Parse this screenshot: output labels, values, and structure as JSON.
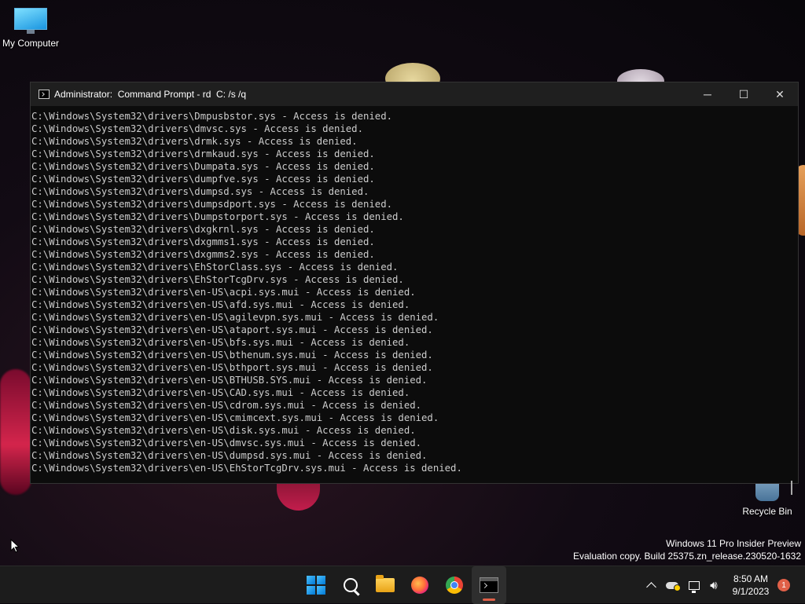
{
  "desktop": {
    "icons": [
      {
        "label": "My Computer",
        "icon": "monitor-icon"
      },
      {
        "label": "Recycle Bin",
        "icon": "recycle-bin-icon"
      }
    ],
    "watermark": {
      "line1": "Windows 11 Pro Insider Preview",
      "line2": "Evaluation copy. Build 25375.zn_release.230520-1632"
    }
  },
  "window": {
    "title": "Administrator:  Command Prompt - rd  C: /s /q",
    "controls": {
      "minimize": "─",
      "maximize": "☐",
      "close": "✕"
    },
    "console_lines": [
      "C:\\Windows\\System32\\drivers\\Dmpusbstor.sys - Access is denied.",
      "C:\\Windows\\System32\\drivers\\dmvsc.sys - Access is denied.",
      "C:\\Windows\\System32\\drivers\\drmk.sys - Access is denied.",
      "C:\\Windows\\System32\\drivers\\drmkaud.sys - Access is denied.",
      "C:\\Windows\\System32\\drivers\\Dumpata.sys - Access is denied.",
      "C:\\Windows\\System32\\drivers\\dumpfve.sys - Access is denied.",
      "C:\\Windows\\System32\\drivers\\dumpsd.sys - Access is denied.",
      "C:\\Windows\\System32\\drivers\\dumpsdport.sys - Access is denied.",
      "C:\\Windows\\System32\\drivers\\Dumpstorport.sys - Access is denied.",
      "C:\\Windows\\System32\\drivers\\dxgkrnl.sys - Access is denied.",
      "C:\\Windows\\System32\\drivers\\dxgmms1.sys - Access is denied.",
      "C:\\Windows\\System32\\drivers\\dxgmms2.sys - Access is denied.",
      "C:\\Windows\\System32\\drivers\\EhStorClass.sys - Access is denied.",
      "C:\\Windows\\System32\\drivers\\EhStorTcgDrv.sys - Access is denied.",
      "C:\\Windows\\System32\\drivers\\en-US\\acpi.sys.mui - Access is denied.",
      "C:\\Windows\\System32\\drivers\\en-US\\afd.sys.mui - Access is denied.",
      "C:\\Windows\\System32\\drivers\\en-US\\agilevpn.sys.mui - Access is denied.",
      "C:\\Windows\\System32\\drivers\\en-US\\ataport.sys.mui - Access is denied.",
      "C:\\Windows\\System32\\drivers\\en-US\\bfs.sys.mui - Access is denied.",
      "C:\\Windows\\System32\\drivers\\en-US\\bthenum.sys.mui - Access is denied.",
      "C:\\Windows\\System32\\drivers\\en-US\\bthport.sys.mui - Access is denied.",
      "C:\\Windows\\System32\\drivers\\en-US\\BTHUSB.SYS.mui - Access is denied.",
      "C:\\Windows\\System32\\drivers\\en-US\\CAD.sys.mui - Access is denied.",
      "C:\\Windows\\System32\\drivers\\en-US\\cdrom.sys.mui - Access is denied.",
      "C:\\Windows\\System32\\drivers\\en-US\\cmimcext.sys.mui - Access is denied.",
      "C:\\Windows\\System32\\drivers\\en-US\\disk.sys.mui - Access is denied.",
      "C:\\Windows\\System32\\drivers\\en-US\\dmvsc.sys.mui - Access is denied.",
      "C:\\Windows\\System32\\drivers\\en-US\\dumpsd.sys.mui - Access is denied.",
      "C:\\Windows\\System32\\drivers\\en-US\\EhStorTcgDrv.sys.mui - Access is denied."
    ]
  },
  "taskbar": {
    "apps": [
      {
        "name": "start",
        "icon": "windows-start-icon"
      },
      {
        "name": "search",
        "icon": "search-icon"
      },
      {
        "name": "file-explorer",
        "icon": "folder-icon"
      },
      {
        "name": "firefox",
        "icon": "firefox-icon"
      },
      {
        "name": "chrome",
        "icon": "chrome-icon"
      },
      {
        "name": "terminal",
        "icon": "terminal-icon",
        "active": true
      }
    ],
    "tray": {
      "time": "8:50 AM",
      "date": "9/1/2023",
      "notification_count": "1"
    },
    "accent_color": "#e06048"
  }
}
